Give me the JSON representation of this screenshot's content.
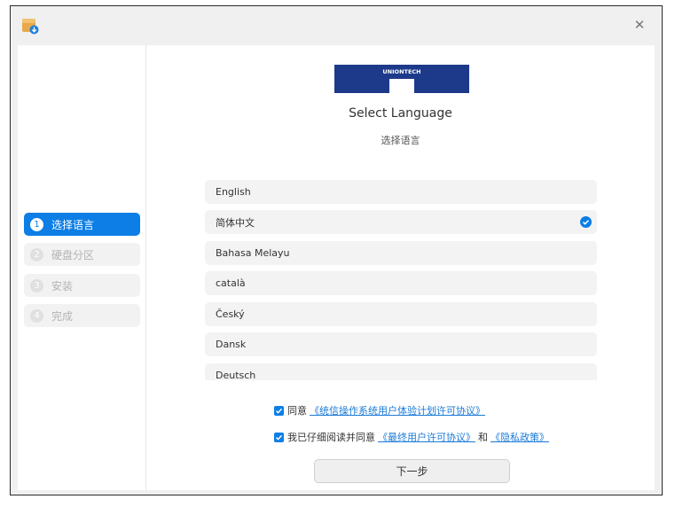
{
  "window": {
    "close_glyph": "✕"
  },
  "logo": {
    "text": "UNIONTECH"
  },
  "header": {
    "title": "Select Language",
    "subtitle": "选择语言"
  },
  "steps": [
    {
      "num": "1",
      "label": "选择语言",
      "active": true
    },
    {
      "num": "2",
      "label": "硬盘分区",
      "active": false
    },
    {
      "num": "3",
      "label": "安装",
      "active": false
    },
    {
      "num": "4",
      "label": "完成",
      "active": false
    }
  ],
  "languages": [
    {
      "label": "English",
      "selected": false
    },
    {
      "label": "简体中文",
      "selected": true
    },
    {
      "label": "Bahasa Melayu",
      "selected": false
    },
    {
      "label": "català",
      "selected": false
    },
    {
      "label": "Český",
      "selected": false
    },
    {
      "label": "Dansk",
      "selected": false
    },
    {
      "label": "Deutsch",
      "selected": false
    }
  ],
  "agreements": {
    "first": {
      "prefix": "同意",
      "link": "《统信操作系统用户体验计划许可协议》"
    },
    "second": {
      "prefix": "我已仔细阅读并同意",
      "link1": "《最终用户许可协议》",
      "conj": "和",
      "link2": "《隐私政策》"
    }
  },
  "next_button": {
    "label": "下一步"
  },
  "colors": {
    "accent": "#0c7ee6",
    "logo_blue": "#1d3a8a",
    "link": "#1a7ad8"
  },
  "icons": {
    "app": "installer-icon",
    "close": "close-icon",
    "check": "check-circle-icon",
    "checkbox": "checkbox-checked-icon"
  }
}
